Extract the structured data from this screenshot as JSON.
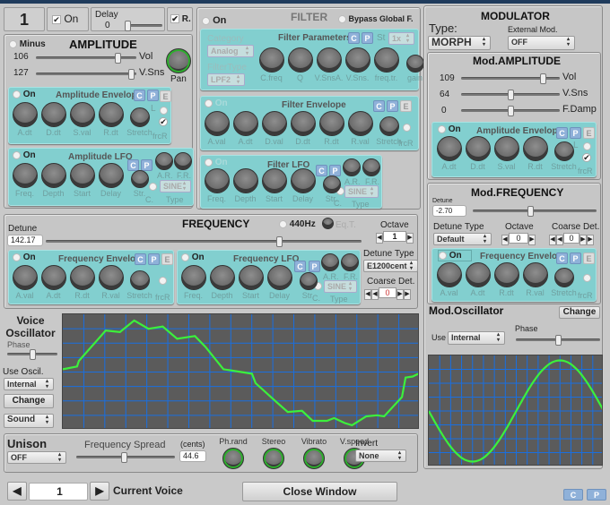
{
  "header": {
    "voice_number": "1",
    "on_label": "On",
    "on_checked": true,
    "delay_label": "Delay",
    "delay_value": "0",
    "delay_fraction": 0.1,
    "r_label": "R.",
    "r_checked": true
  },
  "amplitude": {
    "title": "AMPLITUDE",
    "minus_label": "Minus",
    "vol_value": "106",
    "vol_label": "Vol",
    "vol_fraction": 0.83,
    "vsns_value": "127",
    "vsns_label": "V.Sns",
    "vsns_fraction": 1.0,
    "pan_label": "Pan",
    "envelope": {
      "on_label": "On",
      "title": "Amplitude Envelope",
      "c": "C",
      "p": "P",
      "e": "E",
      "l_label": "L",
      "frcr_label": "frcR",
      "knobs": [
        {
          "label": "A.dt",
          "size": 28
        },
        {
          "label": "D.dt",
          "size": 28
        },
        {
          "label": "S.val",
          "size": 28
        },
        {
          "label": "R.dt",
          "size": 28
        },
        {
          "label": "Stretch",
          "size": 22
        }
      ]
    },
    "lfo": {
      "on_label": "On",
      "title": "Amplitude LFO",
      "c": "C",
      "p": "P",
      "knobs": [
        {
          "label": "Freq.",
          "size": 28
        },
        {
          "label": "Depth",
          "size": 28
        },
        {
          "label": "Start",
          "size": 28
        },
        {
          "label": "Delay",
          "size": 28
        },
        {
          "label": "Str.",
          "size": 20
        }
      ],
      "c_label": "C.",
      "ar_label": "A.R.",
      "fr_label": "F.R.",
      "type_value": "SINE",
      "type_label": "Type"
    }
  },
  "filter": {
    "title": "FILTER",
    "on_label": "On",
    "bypass_label": "Bypass Global F.",
    "params": {
      "title": "Filter Parameters",
      "c": "C",
      "p": "P",
      "st_label": "St",
      "st_value": "1x",
      "category_label": "Category",
      "category_value": "Analog",
      "filtertype_label": "FilterType",
      "filtertype_value": "LPF2",
      "knobs": [
        {
          "label": "C.freq",
          "size": 28
        },
        {
          "label": "Q",
          "size": 28
        },
        {
          "label": "V.SnsA.",
          "size": 28
        },
        {
          "label": "V.Sns.",
          "size": 28
        },
        {
          "label": "freq.tr.",
          "size": 28
        },
        {
          "label": "gain",
          "size": 20
        }
      ]
    },
    "envelope": {
      "on_label": "On",
      "title": "Filter Envelope",
      "c": "C",
      "p": "P",
      "e": "E",
      "frcr_label": "frcR",
      "knobs": [
        {
          "label": "A.val",
          "size": 28
        },
        {
          "label": "A.dt",
          "size": 28
        },
        {
          "label": "D.val",
          "size": 28
        },
        {
          "label": "D.dt",
          "size": 28
        },
        {
          "label": "R.dt",
          "size": 28
        },
        {
          "label": "R.val",
          "size": 28
        },
        {
          "label": "Stretch",
          "size": 22
        }
      ]
    },
    "lfo": {
      "on_label": "On",
      "title": "Filter LFO",
      "c": "C",
      "p": "P",
      "knobs": [
        {
          "label": "Freq.",
          "size": 28
        },
        {
          "label": "Depth",
          "size": 28
        },
        {
          "label": "Start",
          "size": 28
        },
        {
          "label": "Delay",
          "size": 28
        },
        {
          "label": "Str.",
          "size": 20
        }
      ],
      "c_label": "C.",
      "ar_label": "A.R.",
      "fr_label": "F.R.",
      "type_value": "SINE",
      "type_label": "Type"
    }
  },
  "frequency": {
    "title": "FREQUENCY",
    "detune_label": "Detune",
    "detune_value": "142.17",
    "detune_fraction": 0.6,
    "hz440_label": "440Hz",
    "eqt_label": "Eq.T.",
    "octave_label": "Octave",
    "octave_value": "1",
    "detune_type_label": "Detune Type",
    "detune_type_value": "E1200cent",
    "coarse_label": "Coarse Det.",
    "coarse_value": "0",
    "envelope": {
      "on_label": "On",
      "title": "Frequency Envelope",
      "c": "C",
      "p": "P",
      "e": "E",
      "frcr_label": "frcR",
      "knobs": [
        {
          "label": "A.val",
          "size": 28
        },
        {
          "label": "A.dt",
          "size": 28
        },
        {
          "label": "R.dt",
          "size": 28
        },
        {
          "label": "R.val",
          "size": 28
        },
        {
          "label": "Stretch",
          "size": 22
        }
      ]
    },
    "lfo": {
      "on_label": "On",
      "title": "Frequency LFO",
      "c": "C",
      "p": "P",
      "knobs": [
        {
          "label": "Freq.",
          "size": 28
        },
        {
          "label": "Depth",
          "size": 28
        },
        {
          "label": "Start",
          "size": 28
        },
        {
          "label": "Delay",
          "size": 28
        },
        {
          "label": "Str.",
          "size": 20
        }
      ],
      "c_label": "C.",
      "ar_label": "A.R.",
      "fr_label": "F.R.",
      "type_value": "SINE",
      "type_label": "Type"
    }
  },
  "oscillator": {
    "title_line1": "Voice",
    "title_line2": "Oscillator",
    "phase_label": "Phase",
    "phase_fraction": 0.5,
    "use_label": "Use Oscil.",
    "use_value": "Internal",
    "change_label": "Change",
    "sound_value": "Sound",
    "waveform": [
      [
        0,
        0.05
      ],
      [
        0.04,
        0.1
      ],
      [
        0.045,
        0.2
      ],
      [
        0.1,
        0.6
      ],
      [
        0.12,
        0.75
      ],
      [
        0.16,
        0.72
      ],
      [
        0.2,
        0.93
      ],
      [
        0.24,
        0.78
      ],
      [
        0.28,
        0.82
      ],
      [
        0.32,
        0.6
      ],
      [
        0.37,
        0.65
      ],
      [
        0.4,
        0.45
      ],
      [
        0.45,
        0.05
      ],
      [
        0.5,
        0.0
      ],
      [
        0.53,
        -0.03
      ],
      [
        0.54,
        -0.2
      ],
      [
        0.6,
        -0.55
      ],
      [
        0.63,
        -0.72
      ],
      [
        0.67,
        -0.7
      ],
      [
        0.7,
        -0.88
      ],
      [
        0.74,
        -0.88
      ],
      [
        0.76,
        -0.83
      ],
      [
        0.79,
        -0.92
      ],
      [
        0.81,
        -0.96
      ],
      [
        0.85,
        -0.8
      ],
      [
        0.88,
        -0.78
      ],
      [
        0.9,
        -0.8
      ],
      [
        0.95,
        -0.45
      ],
      [
        0.96,
        -0.1
      ],
      [
        0.98,
        -0.08
      ],
      [
        1,
        -0.02
      ]
    ]
  },
  "unison": {
    "title": "Unison",
    "value": "OFF",
    "spread_label": "Frequency Spread",
    "spread_fraction": 0.5,
    "cents_label": "(cents)",
    "cents_value": "44.6",
    "knobs": [
      {
        "label": "Ph.rand"
      },
      {
        "label": "Stereo"
      },
      {
        "label": "Vibrato"
      },
      {
        "label": "V.speed"
      }
    ],
    "invert_label": "Invert",
    "invert_value": "None"
  },
  "footer": {
    "voice_value": "1",
    "current_voice_label": "Current Voice",
    "close_label": "Close Window",
    "c": "C",
    "p": "P"
  },
  "modulator": {
    "title": "MODULATOR",
    "type_label": "Type:",
    "type_value": "MORPH",
    "ext_label": "External Mod.",
    "ext_value": "OFF",
    "amplitude": {
      "title": "Mod.AMPLITUDE",
      "vol_value": "109",
      "vol_label": "Vol",
      "vol_fraction": 0.85,
      "vsns_value": "64",
      "vsns_label": "V.Sns",
      "vsns_fraction": 0.5,
      "fdamp_value": "0",
      "fdamp_label": "F.Damp",
      "fdamp_fraction": 0.5,
      "envelope": {
        "on_label": "On",
        "title": "Amplitude Envelope",
        "c": "C",
        "p": "P",
        "e": "E",
        "l_label": "L",
        "frcr_label": "frcR",
        "knobs": [
          {
            "label": "A.dt",
            "size": 28
          },
          {
            "label": "D.dt",
            "size": 28
          },
          {
            "label": "S.val",
            "size": 28
          },
          {
            "label": "R.dt",
            "size": 28
          },
          {
            "label": "Stretch",
            "size": 22
          }
        ]
      }
    },
    "frequency": {
      "title": "Mod.FREQUENCY",
      "detune_label": "Detune",
      "detune_value": "-2.70",
      "detune_fraction": 0.45,
      "detune_type_label": "Detune Type",
      "detune_type_value": "Default",
      "octave_label": "Octave",
      "octave_value": "0",
      "coarse_label": "Coarse Det.",
      "coarse_value": "0",
      "envelope": {
        "on_label": "On",
        "title": "Frequency Envelope",
        "c": "C",
        "p": "P",
        "e": "E",
        "frcr_label": "frcR",
        "knobs": [
          {
            "label": "A.val",
            "size": 28
          },
          {
            "label": "A.dt",
            "size": 28
          },
          {
            "label": "R.dt",
            "size": 28
          },
          {
            "label": "R.val",
            "size": 28
          },
          {
            "label": "Stretch",
            "size": 22
          }
        ]
      }
    },
    "oscillator": {
      "title": "Mod.Oscillator",
      "change_label": "Change",
      "use_label": "Use",
      "use_value": "Internal",
      "phase_label": "Phase",
      "phase_fraction": 0.5,
      "waveform_type": "sine",
      "waveform_invert": true
    }
  },
  "colors": {
    "teal": "#82cfcf",
    "wave": "#3cf03c",
    "grid": "#1a6fe0",
    "scope_bg": "#5b5b5b"
  }
}
